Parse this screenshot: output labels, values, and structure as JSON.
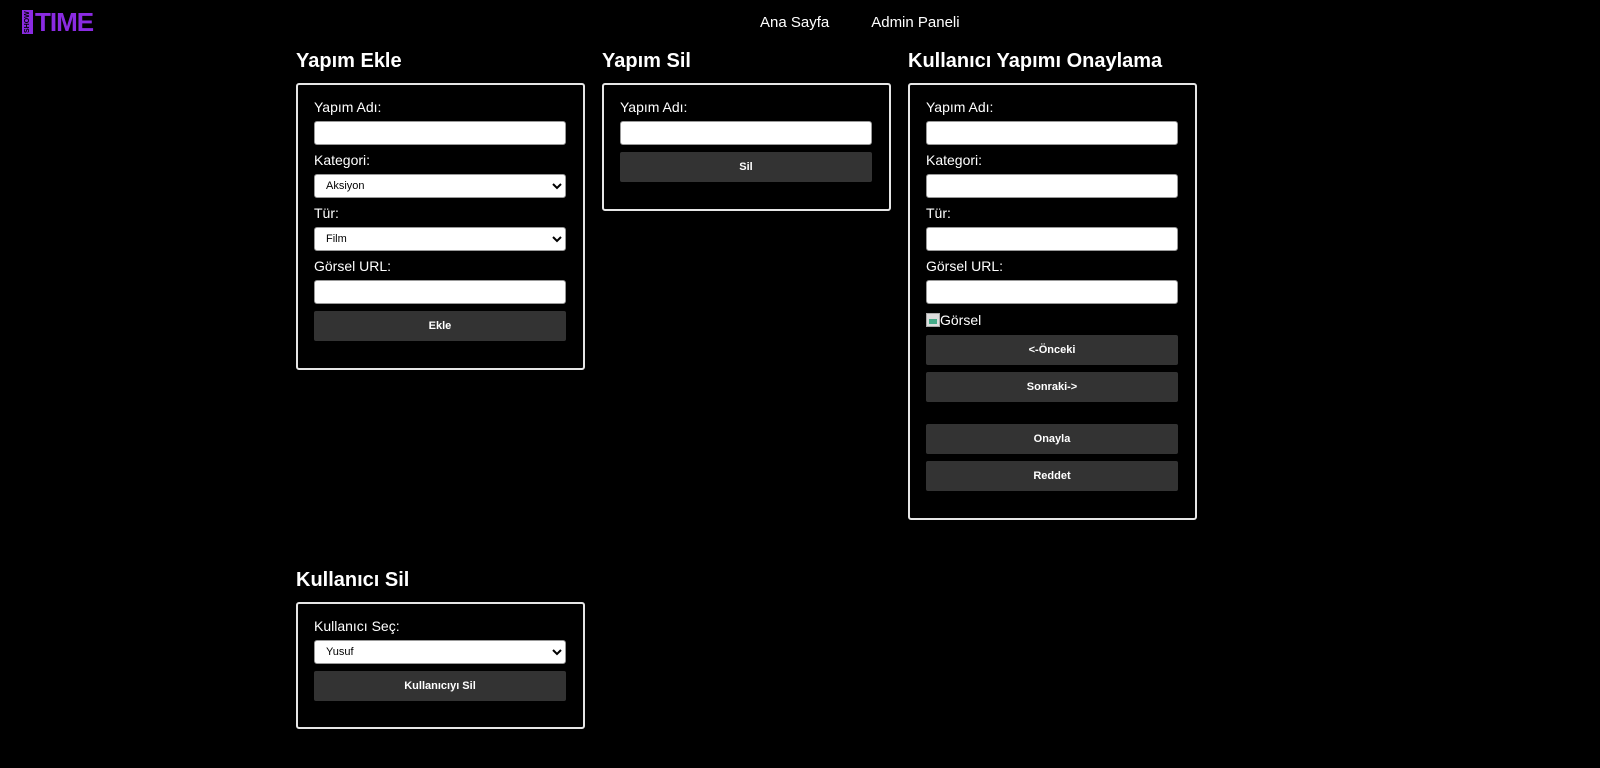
{
  "logo": {
    "small_text": "SHOW",
    "big_text": "TIME",
    "accent": "#8a2be2"
  },
  "nav": {
    "items": [
      "Ana Sayfa",
      "Admin Paneli"
    ]
  },
  "add_production": {
    "title": "Yapım Ekle",
    "name_label": "Yapım Adı:",
    "name_value": "",
    "category_label": "Kategori:",
    "category_selected": "Aksiyon",
    "type_label": "Tür:",
    "type_selected": "Film",
    "image_label": "Görsel URL:",
    "image_value": "",
    "submit_label": "Ekle"
  },
  "delete_production": {
    "title": "Yapım Sil",
    "name_label": "Yapım Adı:",
    "name_value": "",
    "submit_label": "Sil"
  },
  "approve_production": {
    "title": "Kullanıcı Yapımı Onaylama",
    "name_label": "Yapım Adı:",
    "category_label": "Kategori:",
    "type_label": "Tür:",
    "image_label": "Görsel URL:",
    "image_alt": "Görsel",
    "prev_label": "<-Önceki",
    "next_label": "Sonraki->",
    "approve_label": "Onayla",
    "reject_label": "Reddet"
  },
  "delete_user": {
    "title": "Kullanıcı Sil",
    "select_label": "Kullanıcı Seç:",
    "user_selected": "Yusuf",
    "submit_label": "Kullanıcıyı Sil"
  }
}
